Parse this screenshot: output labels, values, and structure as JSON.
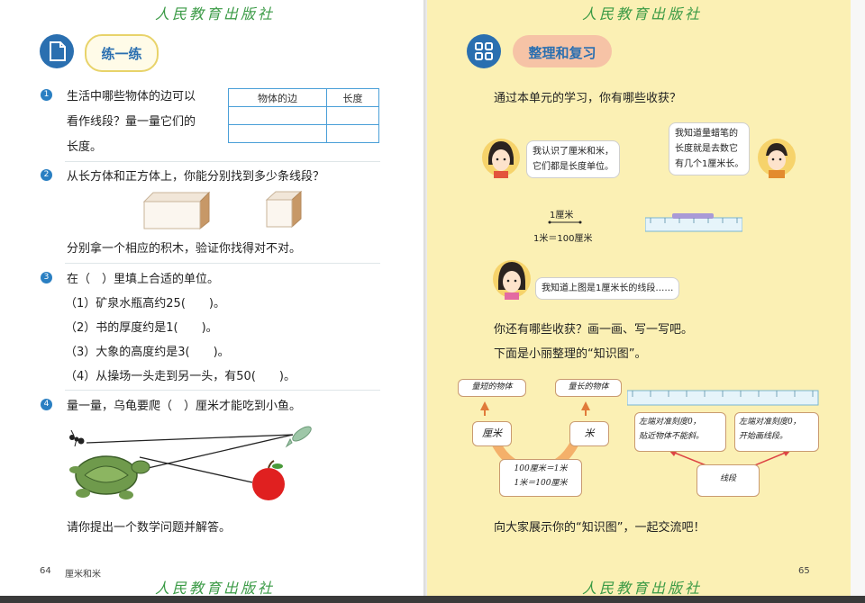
{
  "publisher": "人民教育出版社",
  "left_page": {
    "section_title": "练一练",
    "q1": {
      "number": "1",
      "lines": [
        "生活中哪些物体的边可以",
        "看作线段？量一量它们的",
        "长度。"
      ],
      "table_headers": [
        "物体的边",
        "长度"
      ]
    },
    "q2": {
      "number": "2",
      "text": "从长方体和正方体上，你能分别找到多少条线段？",
      "followup": "分别拿一个相应的积木，验证你找得对不对。"
    },
    "q3": {
      "number": "3",
      "text": "在（　）里填上合适的单位。",
      "items": [
        "（1）矿泉水瓶高约25(　　)。",
        "（2）书的厚度约是1(　　)。",
        "（3）大象的高度约是3(　　)。",
        "（4）从操场一头走到另一头，有50(　　)。"
      ]
    },
    "q4": {
      "number": "4",
      "text": "量一量，乌龟要爬（　）厘米才能吃到小鱼。",
      "followup": "请你提出一个数学问题并解答。"
    },
    "page_number": "64",
    "footer_label": "厘米和米"
  },
  "right_page": {
    "section_title": "整理和复习",
    "intro": "通过本单元的学习，你有哪些收获？",
    "bubble_girl": "我认识了厘米和米，\n它们都是长度单位。",
    "bubble_boy": "我知道量蜡笔的\n长度就是去数它\n有几个1厘米长。",
    "unit_label": "1厘米",
    "unit_equation": "1米＝100厘米",
    "bubble_girl2": "我知道上图是1厘米长的线段……",
    "prompt1": "你还有哪些收获？画一画、写一写吧。",
    "prompt2": "下面是小丽整理的“知识图”。",
    "knowledge_map": {
      "short_objects": "量短的物体",
      "long_objects": "量长的物体",
      "cm": "厘米",
      "m": "米",
      "conversion": "100厘米＝1米\n1米＝100厘米",
      "tip1": "左端对准刻度0，\n贴近物体不能斜。",
      "tip2": "左端对准刻度0，\n开始画线段。",
      "segment": "线段"
    },
    "closing": "向大家展示你的“知识图”，一起交流吧！",
    "page_number": "65"
  },
  "colors": {
    "title_badge_blue": "#2a6fb0",
    "right_page_bg": "#fbf0b4",
    "publisher_green": "#3a9a45",
    "question_badge_blue": "#2a7fc2"
  }
}
